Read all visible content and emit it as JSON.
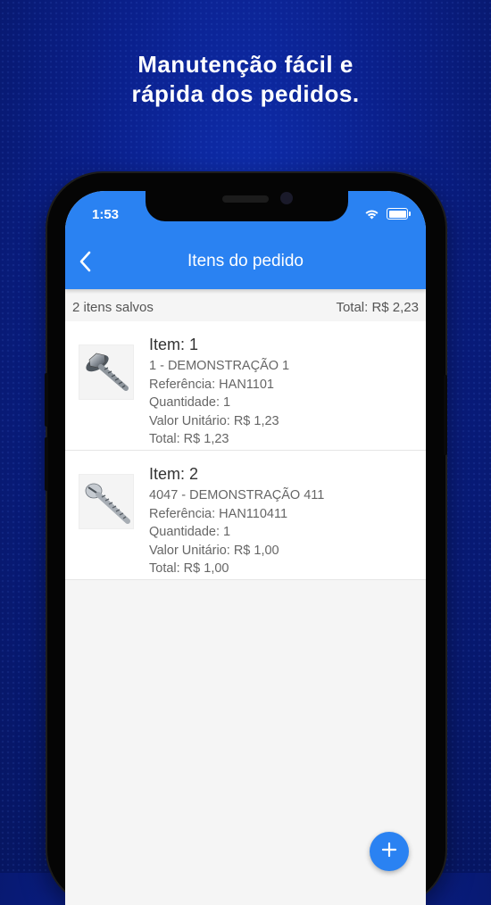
{
  "headline": {
    "line1": "Manutenção fácil e",
    "line2": "rápida dos pedidos."
  },
  "status_bar": {
    "time": "1:53",
    "icons": [
      "wifi-icon",
      "battery-icon"
    ]
  },
  "app_bar": {
    "title": "Itens do pedido",
    "back_icon": "chevron-left-icon"
  },
  "summary": {
    "count_label": "2 itens salvos",
    "total_label": "Total: R$ 2,23"
  },
  "items": [
    {
      "title": "Item: 1",
      "product": "1 - DEMONSTRAÇÃO 1",
      "reference": "Referência: HAN1101",
      "quantity": "Quantidade: 1",
      "unit_value": "Valor Unitário: R$ 1,23",
      "total": "Total: R$ 1,23",
      "image": "hex-washer-screw-image"
    },
    {
      "title": "Item: 2",
      "product": "4047 - DEMONSTRAÇÃO 411",
      "reference": "Referência: HAN110411",
      "quantity": "Quantidade: 1",
      "unit_value": "Valor Unitário: R$ 1,00",
      "total": "Total: R$ 1,00",
      "image": "slotted-screw-image"
    }
  ],
  "fab": {
    "icon": "plus-icon"
  },
  "colors": {
    "primary": "#2a82f2",
    "background": "#0a1f8a",
    "list_background": "#ffffff"
  }
}
